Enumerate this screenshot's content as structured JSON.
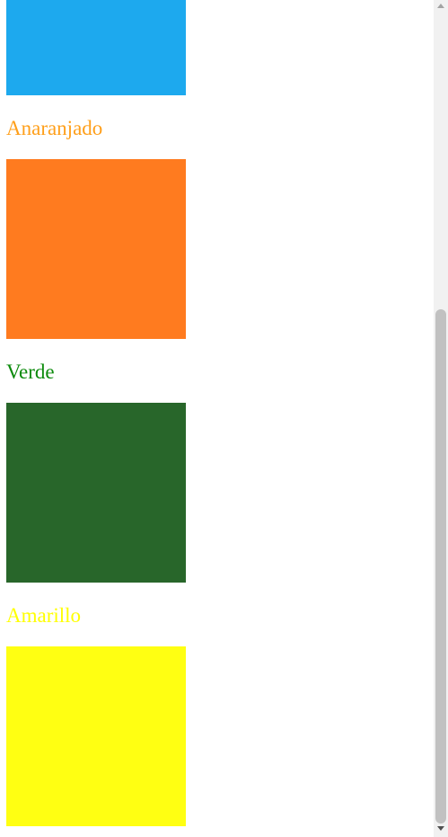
{
  "colors": [
    {
      "name": "",
      "hex": "#1da9ee"
    },
    {
      "name": "Anaranjado",
      "hex": "#ff7b1f",
      "label_color": "#ff9f1a"
    },
    {
      "name": "Verde",
      "hex": "#28662a",
      "label_color": "#0b8a0b"
    },
    {
      "name": "Amarillo",
      "hex": "#ffff12",
      "label_color": "#ffff00"
    }
  ],
  "scrollbar": {
    "position": 0.37
  }
}
